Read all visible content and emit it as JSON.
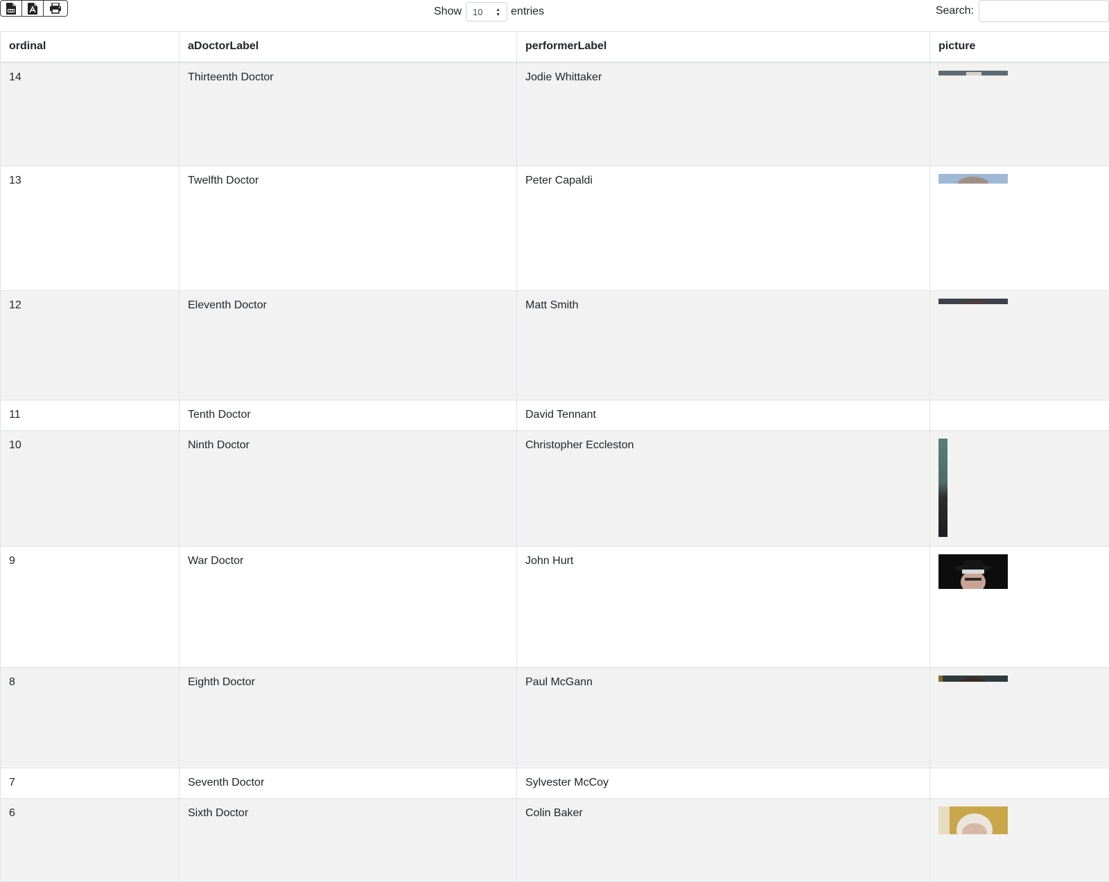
{
  "toolbar": {
    "buttons": [
      {
        "icon": "csv-file-icon"
      },
      {
        "icon": "pdf-file-icon"
      },
      {
        "icon": "print-icon"
      }
    ]
  },
  "length_menu": {
    "show_label": "Show",
    "selected": "10",
    "entries_label": "entries"
  },
  "search": {
    "label": "Search:",
    "value": "",
    "placeholder": ""
  },
  "table": {
    "headers": [
      "ordinal",
      "aDoctorLabel",
      "performerLabel",
      "picture"
    ],
    "rows": [
      {
        "ordinal": "14",
        "doctor": "Thirteenth Doctor",
        "performer": "Jodie Whittaker",
        "picture": "portrait-jodie-whittaker"
      },
      {
        "ordinal": "13",
        "doctor": "Twelfth Doctor",
        "performer": "Peter Capaldi",
        "picture": "portrait-peter-capaldi"
      },
      {
        "ordinal": "12",
        "doctor": "Eleventh Doctor",
        "performer": "Matt Smith",
        "picture": "portrait-matt-smith"
      },
      {
        "ordinal": "11",
        "doctor": "Tenth Doctor",
        "performer": "David Tennant",
        "picture": ""
      },
      {
        "ordinal": "10",
        "doctor": "Ninth Doctor",
        "performer": "Christopher Eccleston",
        "picture": "portrait-christopher-eccleston"
      },
      {
        "ordinal": "9",
        "doctor": "War Doctor",
        "performer": "John Hurt",
        "picture": "portrait-john-hurt"
      },
      {
        "ordinal": "8",
        "doctor": "Eighth Doctor",
        "performer": "Paul McGann",
        "picture": "portrait-paul-mcgann"
      },
      {
        "ordinal": "7",
        "doctor": "Seventh Doctor",
        "performer": "Sylvester McCoy",
        "picture": ""
      },
      {
        "ordinal": "6",
        "doctor": "Sixth Doctor",
        "performer": "Colin Baker",
        "picture": "portrait-colin-baker"
      }
    ]
  }
}
